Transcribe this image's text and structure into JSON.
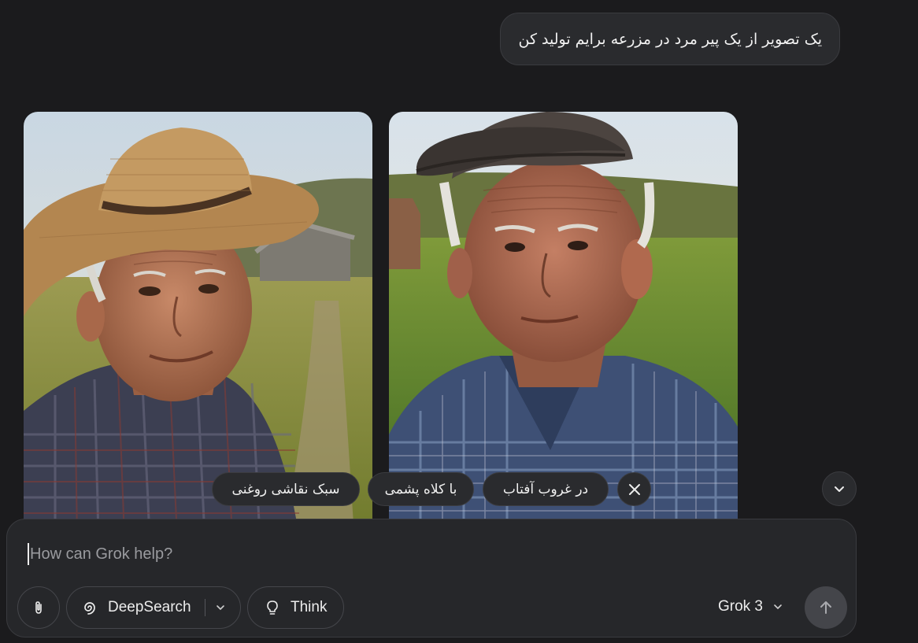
{
  "conversation": {
    "user_message": "یک تصویر از یک پیر مرد در مزرعه برایم تولید کن"
  },
  "generated_images": [
    {
      "name": "farmer-straw-hat"
    },
    {
      "name": "farmer-cap"
    }
  ],
  "suggestions": {
    "items": [
      "در غروب آفتاب",
      "با کلاه پشمی",
      "سبک نقاشی روغنی"
    ]
  },
  "composer": {
    "placeholder": "How can Grok help?",
    "deepsearch_label": "DeepSearch",
    "think_label": "Think",
    "model_label": "Grok 3"
  },
  "icons": {
    "attach": "paperclip-icon",
    "deepsearch": "deepsearch-swirl-icon",
    "think": "lightbulb-icon",
    "send": "arrow-up-icon",
    "close": "close-icon",
    "scroll": "chevron-down-icon"
  },
  "colors": {
    "background": "#1b1b1d",
    "surface": "#2a2b2e",
    "send_button": "#44454a"
  }
}
